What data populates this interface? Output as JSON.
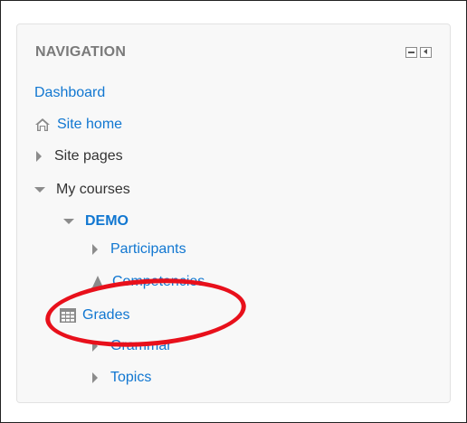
{
  "navigation": {
    "title": "NAVIGATION",
    "controls": [
      "hide-block-icon",
      "dock-block-icon"
    ],
    "items": [
      {
        "label": "Dashboard",
        "icon": "none"
      },
      {
        "label": "Site home",
        "icon": "home-icon"
      },
      {
        "label": "Site pages",
        "icon": "collapsed-arrow"
      },
      {
        "label": "My courses",
        "icon": "expanded-arrow"
      },
      {
        "label": "DEMO",
        "icon": "expanded-arrow"
      },
      {
        "label": "Participants",
        "icon": "collapsed-arrow"
      },
      {
        "label": "Competencies",
        "icon": "competencies-icon"
      },
      {
        "label": "Grades",
        "icon": "grades-table-icon"
      },
      {
        "label": "Grammar",
        "icon": "collapsed-arrow"
      },
      {
        "label": "Topics",
        "icon": "collapsed-arrow"
      }
    ]
  },
  "annotation": {
    "shape": "red-oval-highlight",
    "target": "Grades",
    "color": "#e8101b"
  },
  "colors": {
    "link": "#1177d1",
    "heading": "#7a7a7a",
    "text": "#333333",
    "block_bg": "#f8f8f8"
  }
}
